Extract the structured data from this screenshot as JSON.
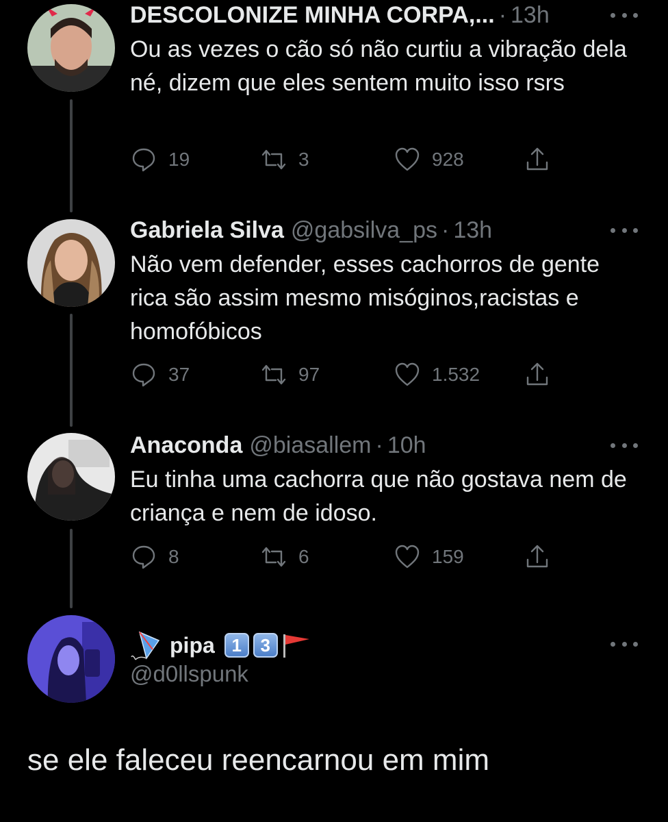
{
  "tweets": [
    {
      "name": "DESCOLONIZE MINHA CORPA,...",
      "handle": "",
      "dot": "·",
      "time": "13h",
      "text": "Ou as vezes o cão só não curtiu a vibração dela né, dizem que eles sentem muito isso rsrs",
      "replies": "19",
      "retweets": "3",
      "likes": "928"
    },
    {
      "name": "Gabriela Silva",
      "handle": "@gabsilva_ps",
      "dot": "·",
      "time": "13h",
      "text": "Não vem defender, esses cachorros de gente rica são assim mesmo misóginos,racistas e homofóbicos",
      "replies": "37",
      "retweets": "97",
      "likes": "1.532"
    },
    {
      "name": "Anaconda",
      "handle": "@biasallem",
      "dot": "·",
      "time": "10h",
      "text": "Eu tinha uma cachorra que não gostava nem de criança e nem de idoso.",
      "replies": "8",
      "retweets": "6",
      "likes": "159"
    }
  ],
  "main_tweet": {
    "name": "pipa",
    "badges": [
      "1",
      "3"
    ],
    "handle": "@d0llspunk",
    "text": "se ele faleceu reencarnou em mim"
  },
  "icons": {
    "reply": "reply-icon",
    "retweet": "retweet-icon",
    "like": "heart-icon",
    "share": "share-icon",
    "more": "more-icon",
    "kite": "kite-icon",
    "flag": "flag-icon"
  },
  "colors": {
    "background": "#000000",
    "text": "#e7e9ea",
    "muted": "#71767b",
    "thread_line": "#3e4144"
  }
}
